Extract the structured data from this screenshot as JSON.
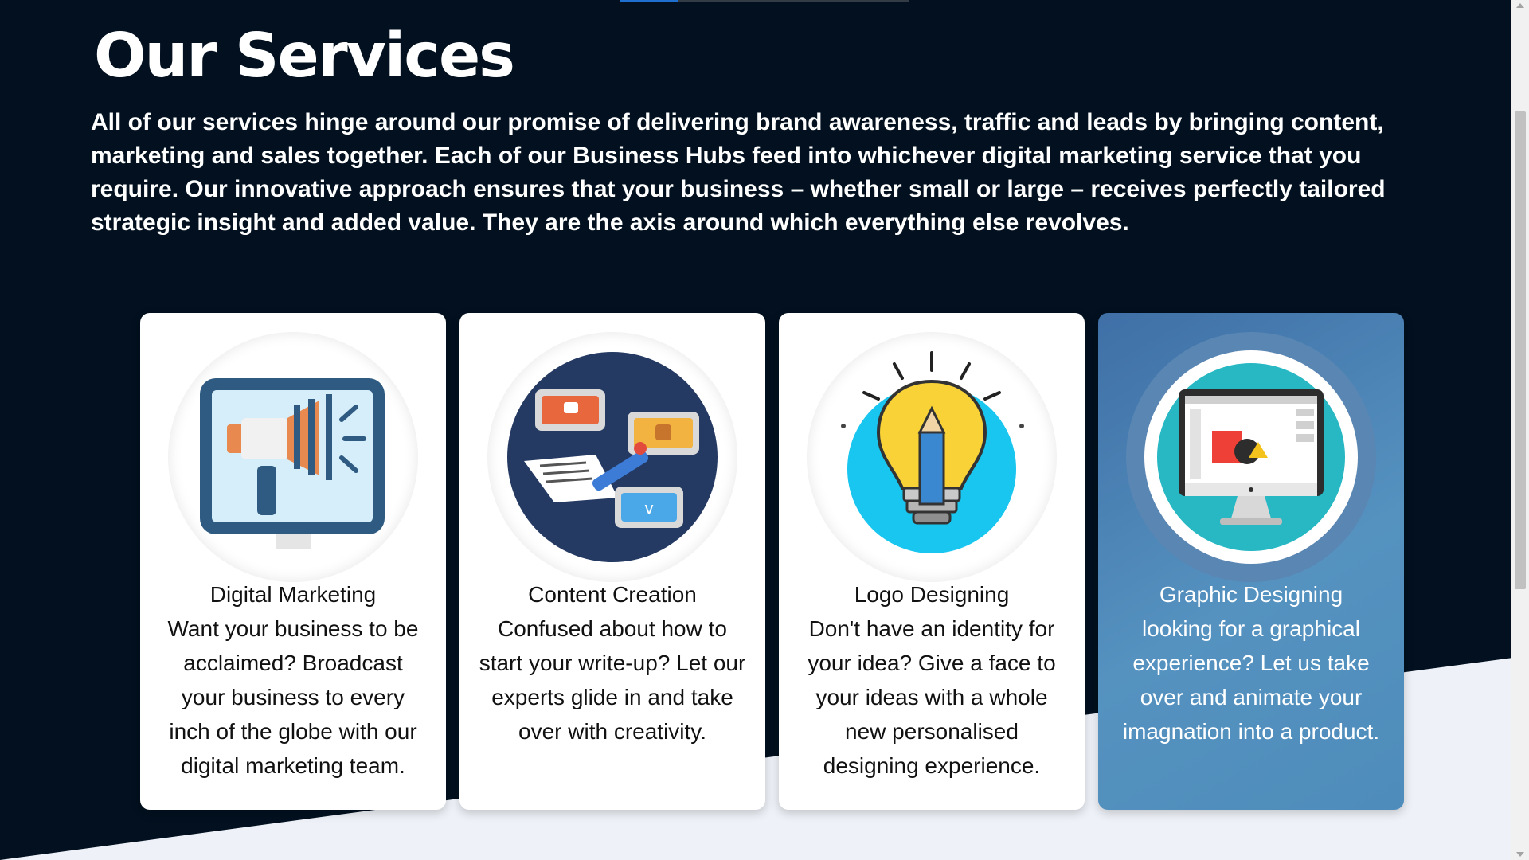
{
  "page": {
    "title": "Our Services",
    "intro": "All of our services hinge around our promise of delivering brand awareness, traffic and leads by bringing content, marketing and sales together. Each of our Business Hubs feed into whichever digital marketing service that you require. Our innovative approach ensures that your business – whether small or large – receives perfectly tailored strategic insight and added value. They are the axis around which everything else revolves."
  },
  "progress": {
    "fraction": 0.2
  },
  "services": [
    {
      "title": "Digital Marketing",
      "description": "Want your business to be acclaimed? Broadcast your business to every inch of the globe with our digital marketing team.",
      "icon": "megaphone-monitor-icon"
    },
    {
      "title": "Content Creation",
      "description": "Confused about how to start your write-up? Let our experts glide in and take over with creativity.",
      "icon": "content-creation-icon"
    },
    {
      "title": "Logo Designing",
      "description": "Don't have an identity for your idea? Give a face to your ideas with a whole new personalised designing experience.",
      "icon": "light-bulb-pencil-icon"
    },
    {
      "title": "Graphic Designing",
      "description": "looking for a graphical experience? Let us take over and animate your imagnation into a product.",
      "icon": "design-monitor-icon"
    }
  ],
  "colors": {
    "background_dark": "#02101f",
    "background_light": "#eef2f8",
    "accent_blue": "#1f6fd1",
    "active_card": "#4e8cbb"
  }
}
